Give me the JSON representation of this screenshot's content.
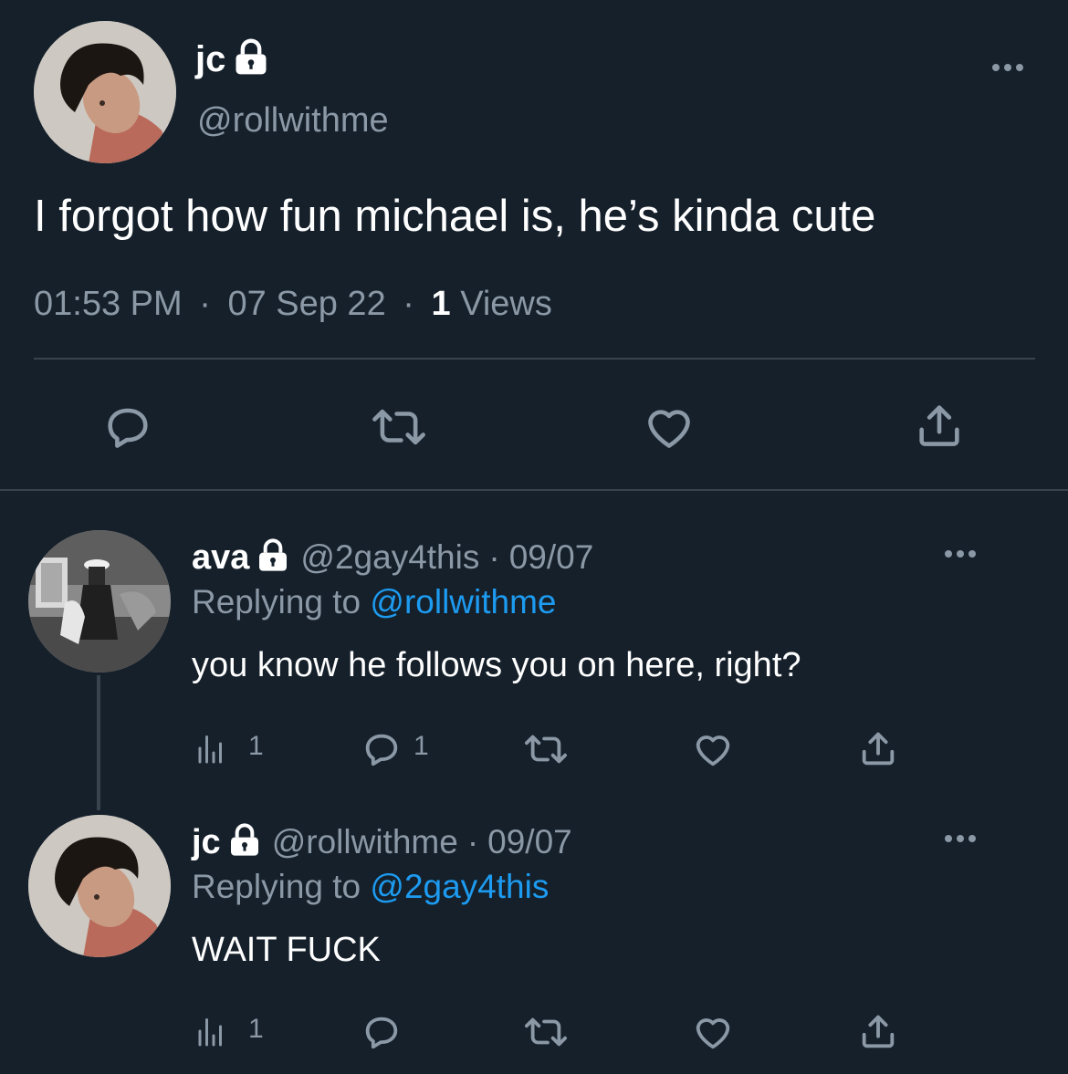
{
  "colors": {
    "background": "#15202b",
    "text": "#ffffff",
    "muted": "#8b98a5",
    "link": "#1d9bf0",
    "divider": "#38444d"
  },
  "main_tweet": {
    "name": "jc",
    "handle": "@rollwithme",
    "text": "I forgot how fun michael is, he’s kinda cute",
    "time": "01:53 PM",
    "date": "07 Sep 22",
    "views_count": "1",
    "views_label": "Views",
    "sep": "·",
    "actions": [
      "reply-icon",
      "retweet-icon",
      "like-icon",
      "share-icon"
    ]
  },
  "replies": [
    {
      "name": "ava",
      "handle": "@2gay4this",
      "date": "09/07",
      "sep": "·",
      "replying_label": "Replying to",
      "replying_to": "@rollwithme",
      "text": "you know he follows you on here, right?",
      "views": "1",
      "replies": "1"
    },
    {
      "name": "jc",
      "handle": "@rollwithme",
      "date": "09/07",
      "sep": "·",
      "replying_label": "Replying to",
      "replying_to": "@2gay4this",
      "text": "WAIT FUCK",
      "views": "1"
    }
  ]
}
